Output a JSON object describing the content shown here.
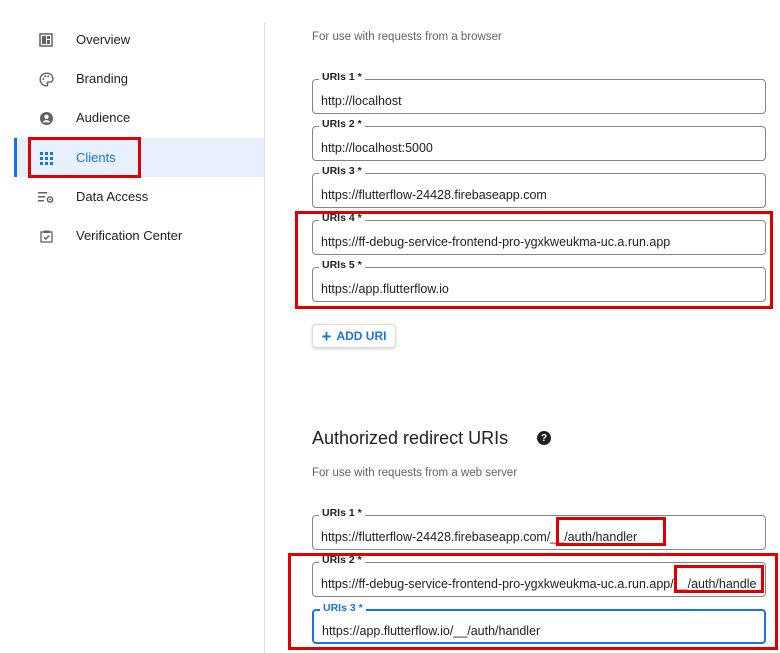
{
  "sidebar": {
    "items": [
      {
        "label": "Overview",
        "icon": "dashboard-icon"
      },
      {
        "label": "Branding",
        "icon": "palette-icon"
      },
      {
        "label": "Audience",
        "icon": "person-icon"
      },
      {
        "label": "Clients",
        "icon": "apps-grid-icon",
        "active": true
      },
      {
        "label": "Data Access",
        "icon": "data-access-icon"
      },
      {
        "label": "Verification Center",
        "icon": "verified-check-icon"
      }
    ]
  },
  "origins": {
    "description": "For use with requests from a browser",
    "uris": [
      {
        "label": "URIs 1 *",
        "value": "http://localhost"
      },
      {
        "label": "URIs 2 *",
        "value": "http://localhost:5000"
      },
      {
        "label": "URIs 3 *",
        "value": "https://flutterflow-24428.firebaseapp.com"
      },
      {
        "label": "URIs 4 *",
        "value": "https://ff-debug-service-frontend-pro-ygxkweukma-uc.a.run.app"
      },
      {
        "label": "URIs 5 *",
        "value": "https://app.flutterflow.io"
      }
    ],
    "add_label": "ADD URI"
  },
  "redirects": {
    "title": "Authorized redirect URIs",
    "description": "For use with requests from a web server",
    "uris": [
      {
        "label": "URIs 1 *",
        "value": "https://flutterflow-24428.firebaseapp.com/__/auth/handler"
      },
      {
        "label": "URIs 2 *",
        "value": "https://ff-debug-service-frontend-pro-ygxkweukma-uc.a.run.app/__/auth/handler"
      },
      {
        "label": "URIs 3 *",
        "value": "https://app.flutterflow.io/__/auth/handler"
      }
    ]
  },
  "colors": {
    "accent": "#1a73e8",
    "highlight": "#e00000",
    "active_bg": "#e8f0fe"
  }
}
